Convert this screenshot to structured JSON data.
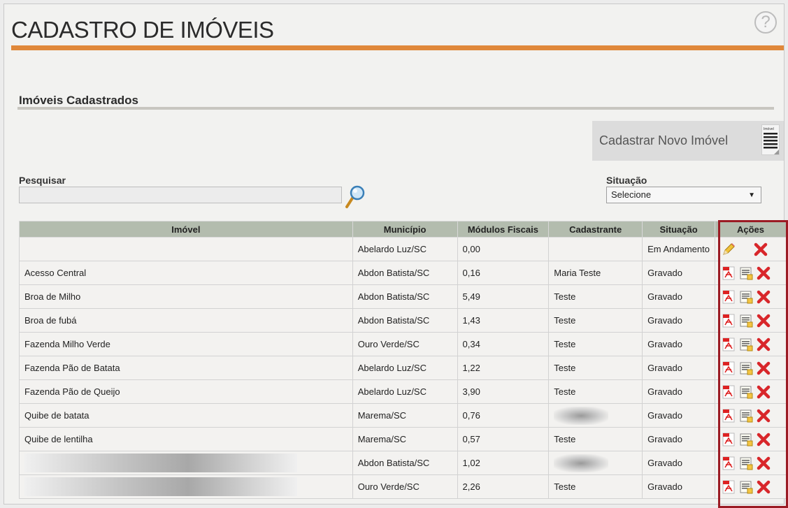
{
  "page": {
    "title": "CADASTRO DE IMÓVEIS",
    "help_glyph": "?"
  },
  "section": {
    "title": "Imóveis Cadastrados"
  },
  "new_button": {
    "label": "Cadastrar Novo Imóvel",
    "icon_text": "Imóvel"
  },
  "search": {
    "label": "Pesquisar",
    "value": ""
  },
  "filter": {
    "label": "Situação",
    "selected": "Selecione"
  },
  "table": {
    "columns": [
      "Imóvel",
      "Município",
      "Módulos Fiscais",
      "Cadastrante",
      "Situação",
      "Ações"
    ],
    "rows": [
      {
        "imovel": "",
        "municipio": "Abelardo Luz/SC",
        "modulos": "0,00",
        "cadastrante": "",
        "situacao": "Em Andamento"
      },
      {
        "imovel": "Acesso Central",
        "municipio": "Abdon Batista/SC",
        "modulos": "0,16",
        "cadastrante": "Maria Teste",
        "situacao": "Gravado"
      },
      {
        "imovel": "Broa de Milho",
        "municipio": "Abdon Batista/SC",
        "modulos": "5,49",
        "cadastrante": "Teste",
        "situacao": "Gravado"
      },
      {
        "imovel": "Broa de fubá",
        "municipio": "Abdon Batista/SC",
        "modulos": "1,43",
        "cadastrante": "Teste",
        "situacao": "Gravado"
      },
      {
        "imovel": "Fazenda Milho Verde",
        "municipio": "Ouro Verde/SC",
        "modulos": "0,34",
        "cadastrante": "Teste",
        "situacao": "Gravado"
      },
      {
        "imovel": "Fazenda Pão de Batata",
        "municipio": "Abelardo Luz/SC",
        "modulos": "1,22",
        "cadastrante": "Teste",
        "situacao": "Gravado"
      },
      {
        "imovel": "Fazenda Pão de Queijo",
        "municipio": "Abelardo Luz/SC",
        "modulos": "3,90",
        "cadastrante": "Teste",
        "situacao": "Gravado"
      },
      {
        "imovel": "Quibe de batata",
        "municipio": "Marema/SC",
        "modulos": "0,76",
        "cadastrante": "",
        "situacao": "Gravado"
      },
      {
        "imovel": "Quibe de lentilha",
        "municipio": "Marema/SC",
        "modulos": "0,57",
        "cadastrante": "Teste",
        "situacao": "Gravado"
      },
      {
        "imovel": "",
        "municipio": "Abdon Batista/SC",
        "modulos": "1,02",
        "cadastrante": "",
        "situacao": "Gravado"
      },
      {
        "imovel": "",
        "municipio": "Ouro Verde/SC",
        "modulos": "2,26",
        "cadastrante": "Teste",
        "situacao": "Gravado"
      }
    ]
  },
  "colors": {
    "accent_bar": "#e0883a",
    "header_bg": "#b3bcae",
    "highlight_border": "#9b1b24",
    "delete_red": "#d8262a"
  },
  "icons": {
    "edit": "pencil-icon",
    "pdf": "pdf-icon",
    "report": "report-icon",
    "delete": "delete-x-icon",
    "search": "magnifier-icon"
  }
}
